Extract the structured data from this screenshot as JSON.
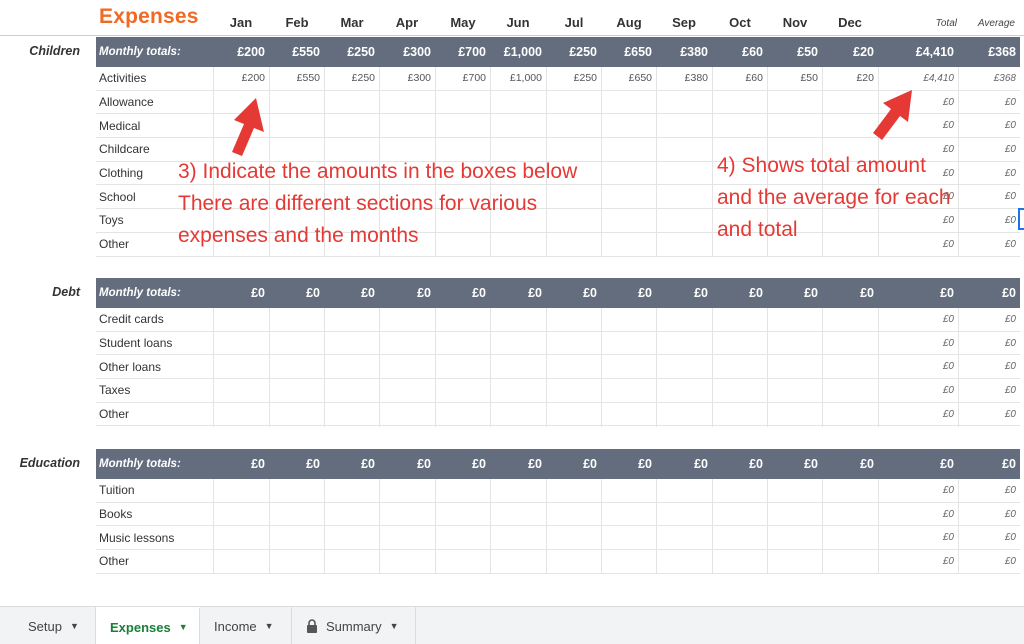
{
  "sheet_title": "Expenses",
  "months": [
    "Jan",
    "Feb",
    "Mar",
    "Apr",
    "May",
    "Jun",
    "Jul",
    "Aug",
    "Sep",
    "Oct",
    "Nov",
    "Dec"
  ],
  "total_header": "Total",
  "average_header": "Average",
  "sections": [
    {
      "name": "Children",
      "totals_label": "Monthly totals:",
      "totals": [
        "£200",
        "£550",
        "£250",
        "£300",
        "£700",
        "£1,000",
        "£250",
        "£650",
        "£380",
        "£60",
        "£50",
        "£20"
      ],
      "total": "£4,410",
      "average": "£368",
      "rows": [
        {
          "label": "Activities",
          "values": [
            "£200",
            "£550",
            "£250",
            "£300",
            "£700",
            "£1,000",
            "£250",
            "£650",
            "£380",
            "£60",
            "£50",
            "£20"
          ],
          "total": "£4,410",
          "average": "£368"
        },
        {
          "label": "Allowance",
          "values": [],
          "total": "£0",
          "average": "£0"
        },
        {
          "label": "Medical",
          "values": [],
          "total": "£0",
          "average": "£0"
        },
        {
          "label": "Childcare",
          "values": [],
          "total": "£0",
          "average": "£0"
        },
        {
          "label": "Clothing",
          "values": [],
          "total": "£0",
          "average": "£0"
        },
        {
          "label": "School",
          "values": [],
          "total": "£0",
          "average": "£0"
        },
        {
          "label": "Toys",
          "values": [],
          "total": "£0",
          "average": "£0"
        },
        {
          "label": "Other",
          "values": [],
          "total": "£0",
          "average": "£0"
        }
      ]
    },
    {
      "name": "Debt",
      "totals_label": "Monthly totals:",
      "totals": [
        "£0",
        "£0",
        "£0",
        "£0",
        "£0",
        "£0",
        "£0",
        "£0",
        "£0",
        "£0",
        "£0",
        "£0"
      ],
      "total": "£0",
      "average": "£0",
      "rows": [
        {
          "label": "Credit cards",
          "values": [],
          "total": "£0",
          "average": "£0"
        },
        {
          "label": "Student loans",
          "values": [],
          "total": "£0",
          "average": "£0"
        },
        {
          "label": "Other loans",
          "values": [],
          "total": "£0",
          "average": "£0"
        },
        {
          "label": "Taxes",
          "values": [],
          "total": "£0",
          "average": "£0"
        },
        {
          "label": "Other",
          "values": [],
          "total": "£0",
          "average": "£0"
        }
      ]
    },
    {
      "name": "Education",
      "totals_label": "Monthly totals:",
      "totals": [
        "£0",
        "£0",
        "£0",
        "£0",
        "£0",
        "£0",
        "£0",
        "£0",
        "£0",
        "£0",
        "£0",
        "£0"
      ],
      "total": "£0",
      "average": "£0",
      "rows": [
        {
          "label": "Tuition",
          "values": [],
          "total": "£0",
          "average": "£0"
        },
        {
          "label": "Books",
          "values": [],
          "total": "£0",
          "average": "£0"
        },
        {
          "label": "Music lessons",
          "values": [],
          "total": "£0",
          "average": "£0"
        },
        {
          "label": "Other",
          "values": [],
          "total": "£0",
          "average": "£0"
        }
      ]
    }
  ],
  "annotations": {
    "left": [
      "3) Indicate the amounts in the boxes below",
      "There are different sections for various",
      "expenses and the months"
    ],
    "right": [
      "4) Shows total amount",
      "and the average for each",
      "and total"
    ],
    "color": "#e53935"
  },
  "tabs": [
    {
      "label": "Setup",
      "active": false,
      "locked": false
    },
    {
      "label": "Expenses",
      "active": true,
      "locked": false
    },
    {
      "label": "Income",
      "active": false,
      "locked": false
    },
    {
      "label": "Summary",
      "active": false,
      "locked": true
    }
  ],
  "colors": {
    "title": "#f06a24",
    "totals_bar": "#646d7e",
    "active_tab": "#188038"
  }
}
